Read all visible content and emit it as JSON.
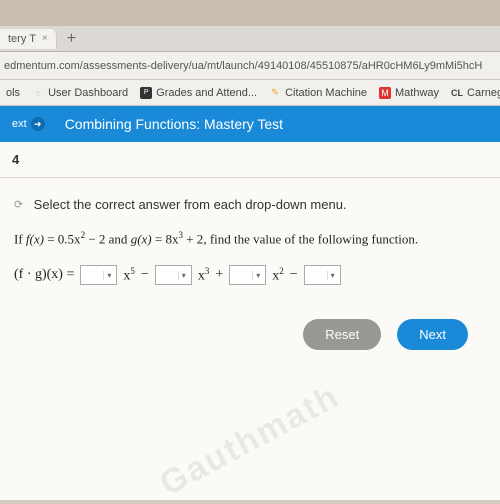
{
  "browser": {
    "tab_title": "tery T",
    "tab_close": "×",
    "new_tab": "+",
    "url": "edmentum.com/assessments-delivery/ua/mt/launch/49140108/45510875/aHR0cHM6Ly9mMi5hcH"
  },
  "bookmarks": {
    "items": [
      {
        "label": "ols"
      },
      {
        "label": "User Dashboard"
      },
      {
        "label": "Grades and Attend..."
      },
      {
        "label": "Citation Machine"
      },
      {
        "label": "Mathway"
      },
      {
        "label": "Carnegie Le"
      }
    ]
  },
  "header": {
    "ext_label": "ext",
    "title": "Combining Functions: Mastery Test"
  },
  "question": {
    "number": "4",
    "instruction": "Select the correct answer from each drop-down menu.",
    "line1_prefix": "If ",
    "fx": "f(x)",
    "eq1": " = 0.5x",
    "exp1": "2",
    "mid1": " − 2 ",
    "and": "and ",
    "gx": "g(x)",
    "eq2": " = 8x",
    "exp2": "3",
    "mid2": " + 2",
    "suffix": ", find the value of the following function.",
    "lhs": "(f · g)(x) = ",
    "term_x5": "x",
    "exp_x5": "5",
    "minus1": " − ",
    "term_x3": "x",
    "exp_x3": "3",
    "plus": " + ",
    "term_x2": "x",
    "exp_x2": "2",
    "minus2": " − "
  },
  "buttons": {
    "reset": "Reset",
    "next": "Next"
  },
  "watermark": "Gauthmath"
}
